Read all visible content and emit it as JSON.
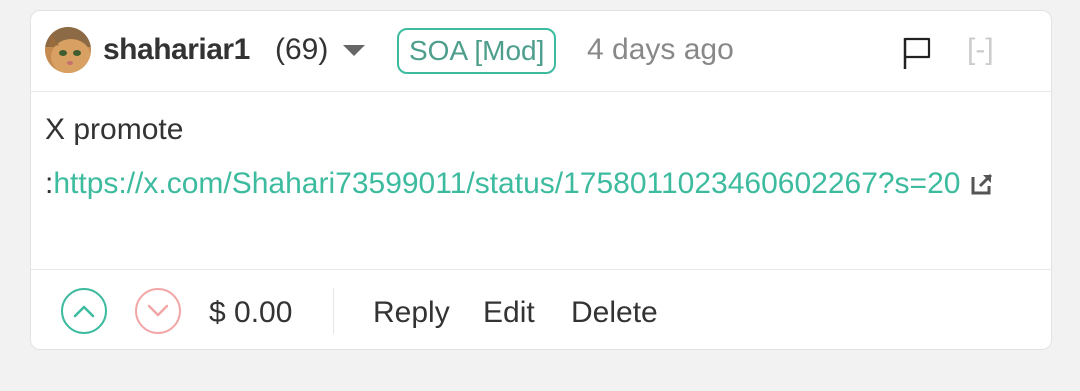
{
  "comment": {
    "author": {
      "username": "shahariar1",
      "reputation": "(69)",
      "avatar_icon": "cat-avatar"
    },
    "community_badge": "SOA [Mod]",
    "timestamp": "4 days ago",
    "collapse_label": "[-]",
    "body": {
      "text": "X promote",
      "link_prefix": ":",
      "link_text": "https://x.com/Shahari73599011/status/1758011023460602267?s=20"
    },
    "footer": {
      "payout": "$ 0.00",
      "reply_label": "Reply",
      "edit_label": "Edit",
      "delete_label": "Delete"
    }
  },
  "colors": {
    "accent": "#3dbb9f",
    "downvote": "#f2a7a7",
    "text": "#333333",
    "muted": "#888888"
  }
}
